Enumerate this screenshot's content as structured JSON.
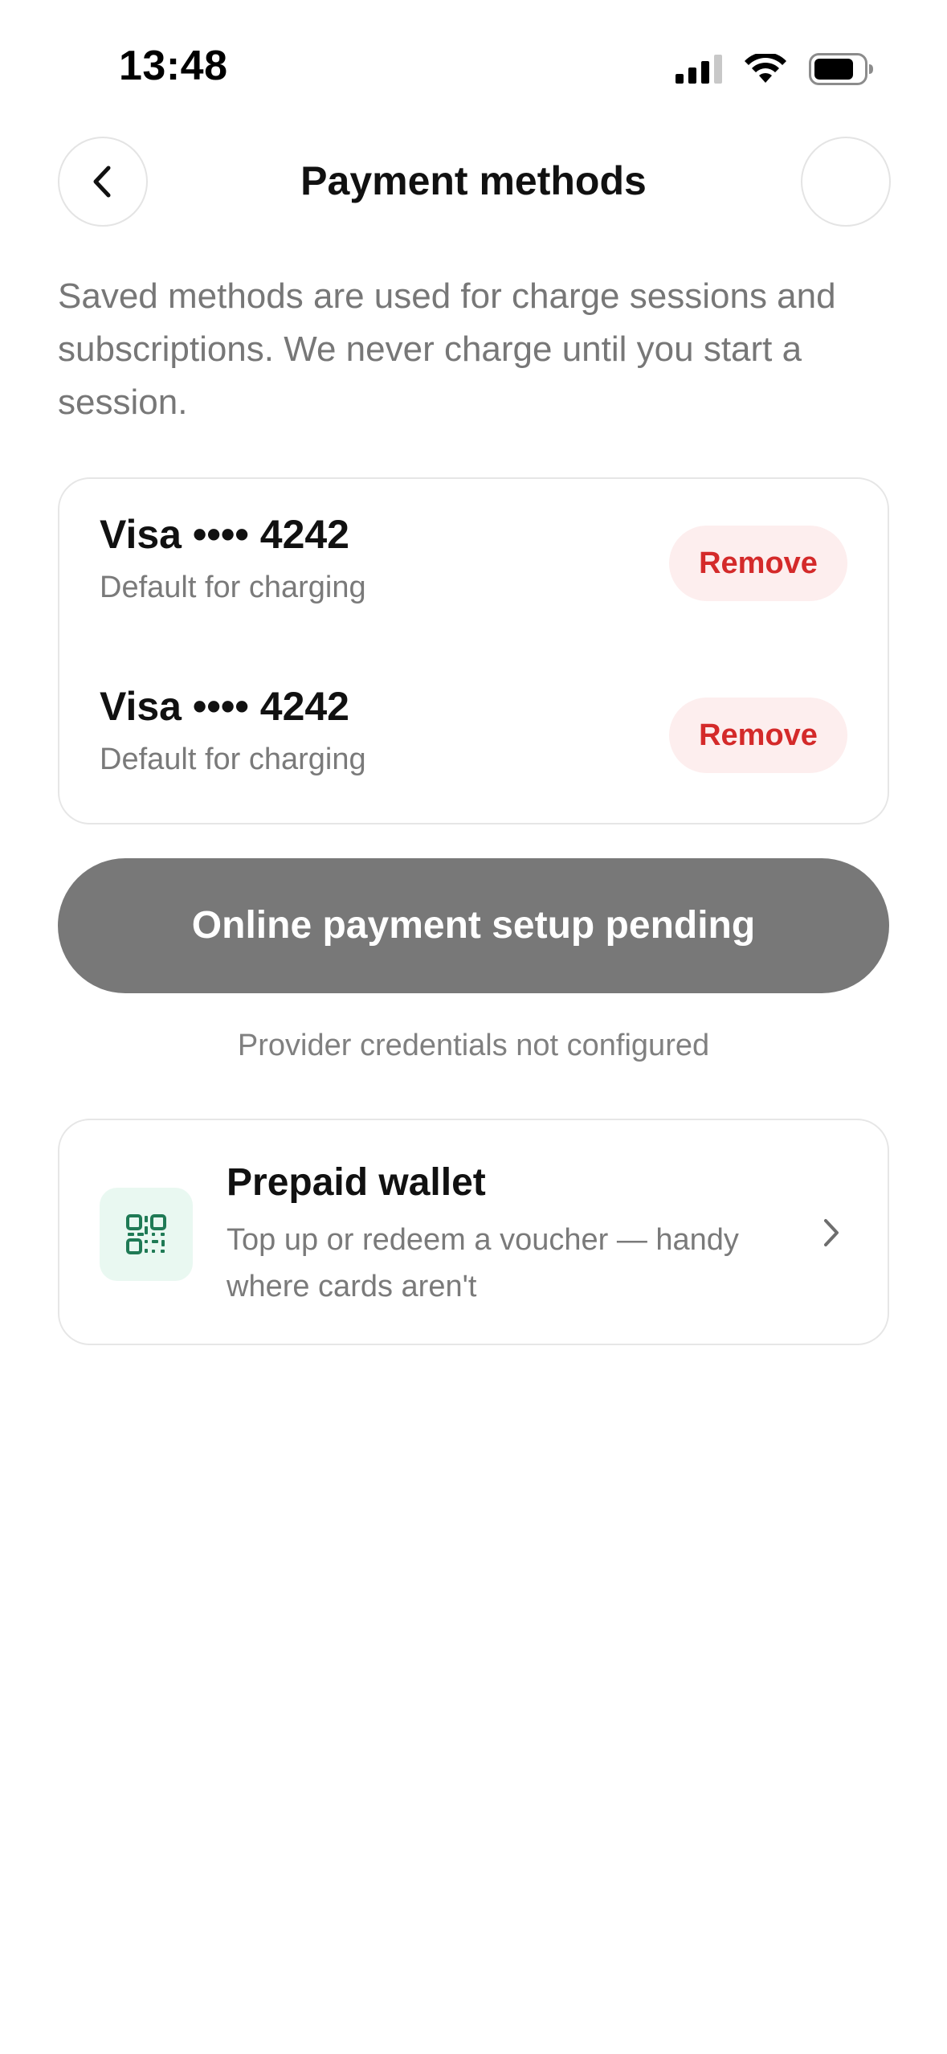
{
  "status_bar": {
    "time": "13:48"
  },
  "header": {
    "title": "Payment methods",
    "back_icon": "chevron-left-icon"
  },
  "intro": "Saved methods are used for charge sessions and subscriptions. We never charge until you start a session.",
  "saved_cards": [
    {
      "name": "Visa •••• 4242",
      "subtitle": "Default for charging",
      "action": "Remove"
    },
    {
      "name": "Visa •••• 4242",
      "subtitle": "Default for charging",
      "action": "Remove"
    }
  ],
  "pending_button": {
    "label": "Online payment setup pending",
    "note": "Provider credentials not configured"
  },
  "wallet": {
    "title": "Prepaid wallet",
    "subtitle": "Top up or redeem a voucher — handy where cards aren't",
    "icon": "qr-code-icon"
  },
  "colors": {
    "remove_text": "#d42a2a",
    "remove_bg": "#fdeeee",
    "pending_bg": "#787878",
    "wallet_icon_bg": "#e9f8f1",
    "wallet_icon_fg": "#1f7a55"
  }
}
